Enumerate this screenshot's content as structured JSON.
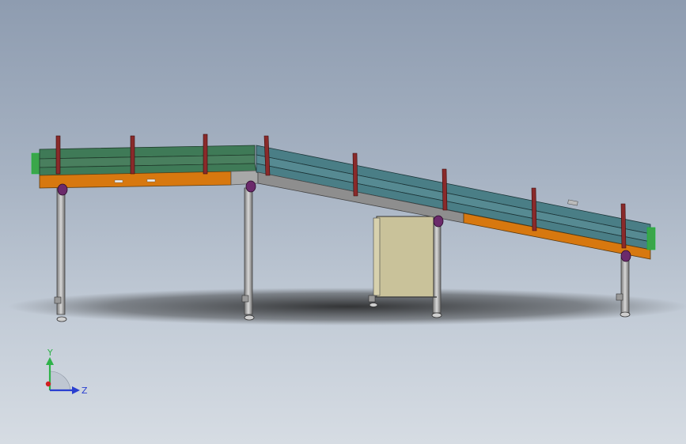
{
  "viewport": {
    "background_top": "#8e9cb0",
    "background_bottom": "#d6dce3"
  },
  "model": {
    "colors": {
      "green_belt": "#3f7a57",
      "teal_belt": "#4a7e86",
      "orange_frame": "#d7780f",
      "gray_frame": "#8e8e8e",
      "guide_post": "#8a2a2a",
      "bearing": "#6b2a6b",
      "leg": "#b5b5b5",
      "cabinet": "#c9c29a"
    }
  },
  "triad": {
    "y_label": "Y",
    "z_label": "Z",
    "y_color": "#2fb24a",
    "z_color": "#2a3fd0",
    "x_color": "#d02020"
  }
}
